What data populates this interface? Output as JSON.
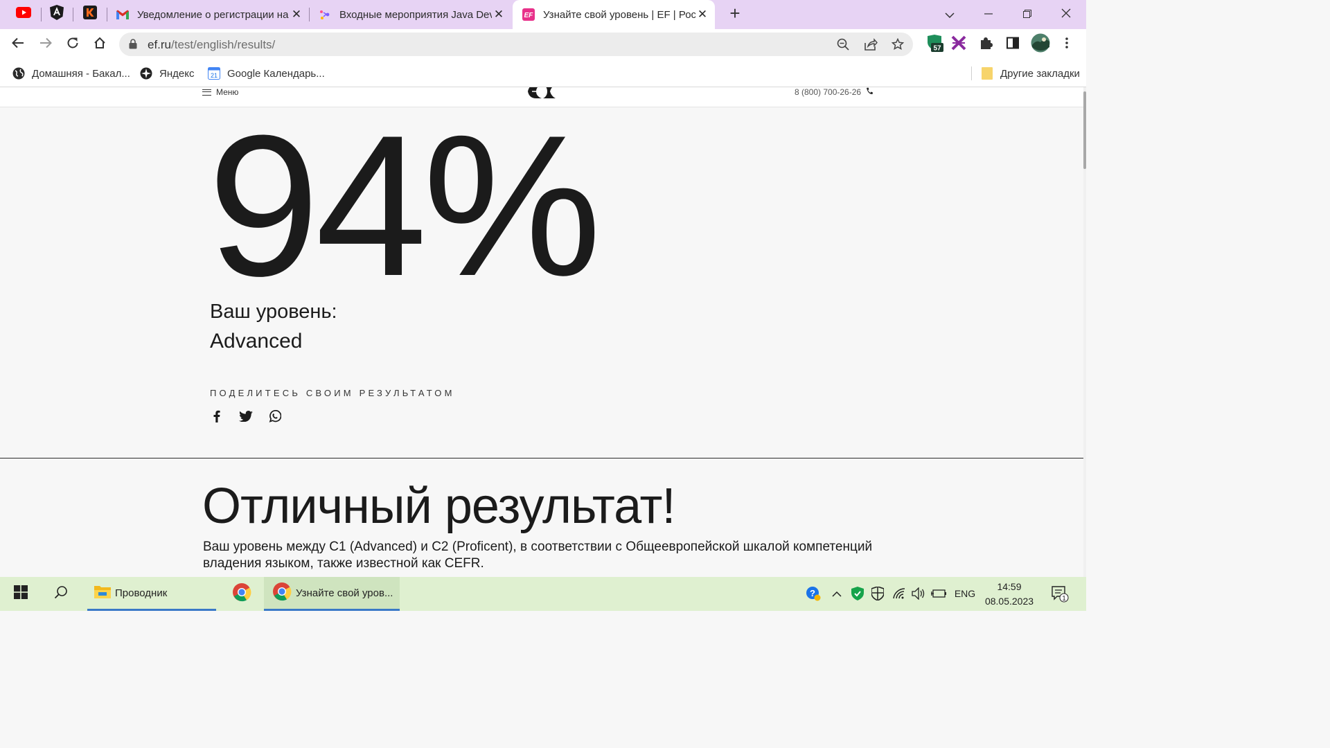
{
  "browser": {
    "tabs": [
      {
        "title": "Уведомление о регистрации на",
        "icon": "gmail-icon",
        "active": false
      },
      {
        "title": "Входные мероприятия Java Dev",
        "icon": "event-icon",
        "active": false
      },
      {
        "title": "Узнайте свой уровень | EF | Росс",
        "icon": "ef-icon",
        "active": true
      }
    ],
    "url_host": "ef.ru",
    "url_path": "/test/english/results/",
    "extension_badge": "57",
    "bookmarks": [
      {
        "label": "Домашняя - Бакал...",
        "icon": "globe-icon"
      },
      {
        "label": "Яндекс",
        "icon": "yandex-icon"
      },
      {
        "label": "Google Календарь...",
        "icon": "calendar-icon",
        "icon_text": "21"
      }
    ],
    "other_bookmarks": "Другие закладки"
  },
  "site": {
    "menu_label": "Меню",
    "phone": "8 (800) 700-26-26"
  },
  "result": {
    "score": "94%",
    "score_value": 94,
    "level_label": "Ваш уровень:",
    "level": "Advanced",
    "share_title": "ПОДЕЛИТЕСЬ СВОИМ РЕЗУЛЬТАТОМ",
    "headline": "Отличный результат!",
    "description": "Ваш уровень между C1 (Advanced) и C2 (Proficent), в соответствии с Общеевропейской шкалой компетенций владения языком, также известной как CEFR."
  },
  "taskbar": {
    "explorer_label": "Проводник",
    "chrome_window_label": "Узнайте свой уров...",
    "language": "ENG",
    "time": "14:59",
    "date": "08.05.2023",
    "notification_count": "1"
  },
  "colors": {
    "tab_strip": "#e7d3f4",
    "taskbar": "#dff0d0",
    "page_bg": "#f7f7f7",
    "ef_pink": "#e8318a",
    "text": "#1b1b1b"
  }
}
